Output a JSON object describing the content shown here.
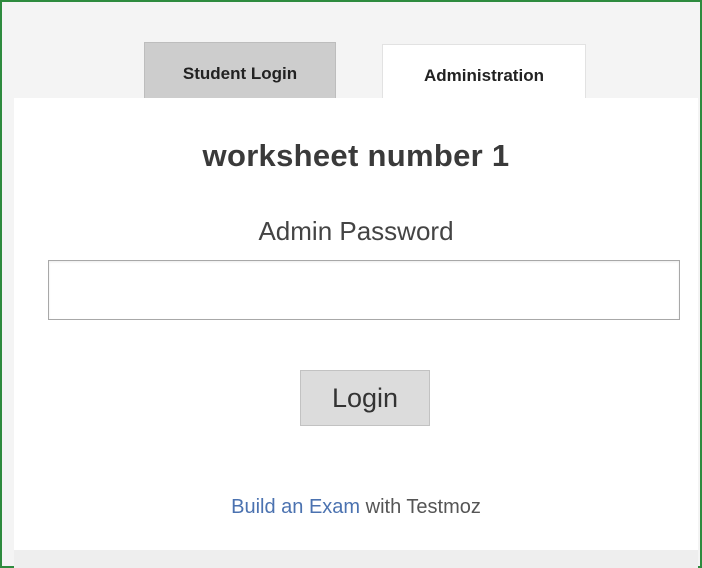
{
  "tabs": {
    "student": "Student Login",
    "admin": "Administration"
  },
  "panel": {
    "title": "worksheet number 1",
    "password_label": "Admin Password",
    "password_value": "",
    "login_label": "Login"
  },
  "footer": {
    "link_text": "Build an Exam",
    "suffix_text": " with Testmoz"
  },
  "colors": {
    "border": "#2e8b3e",
    "link": "#4b72b0",
    "active_tab_bg": "#ffffff",
    "inactive_tab_bg": "#cdcdcd"
  }
}
